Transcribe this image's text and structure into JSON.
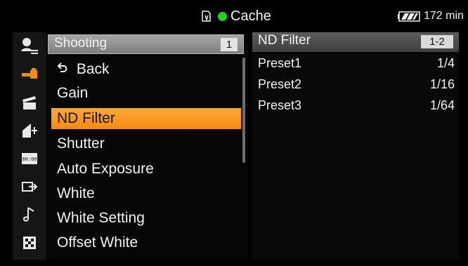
{
  "statusbar": {
    "title": "Cache",
    "battery_text": "172 min",
    "colors": {
      "dot": "#25d11c",
      "battery": "#f2f2f2"
    },
    "icons": [
      "memory-card-icon",
      "green-dot-icon",
      "battery-icon"
    ]
  },
  "menu": {
    "header": {
      "title": "Shooting",
      "page": "1"
    },
    "items": [
      {
        "label": "Back",
        "icon": "back-arrow-icon",
        "selected": false
      },
      {
        "label": "Gain",
        "selected": false
      },
      {
        "label": "ND Filter",
        "selected": true
      },
      {
        "label": "Shutter",
        "selected": false
      },
      {
        "label": "Auto Exposure",
        "selected": false
      },
      {
        "label": "White",
        "selected": false
      },
      {
        "label": "White Setting",
        "selected": false
      },
      {
        "label": "Offset White",
        "selected": false
      }
    ],
    "colors": {
      "selected": "#ff9d22"
    }
  },
  "right_panel": {
    "title": "ND Filter",
    "page": "1-2",
    "rows": [
      {
        "name": "Preset1",
        "value": "1/4"
      },
      {
        "name": "Preset2",
        "value": "1/16"
      },
      {
        "name": "Preset3",
        "value": "1/64"
      }
    ]
  },
  "sidebar": {
    "icons": [
      "user-menu-icon",
      "camera-icon",
      "clapperboard-icon",
      "paint-icon",
      "timecode-icon",
      "output-icon",
      "music-icon",
      "grid-icon"
    ]
  }
}
